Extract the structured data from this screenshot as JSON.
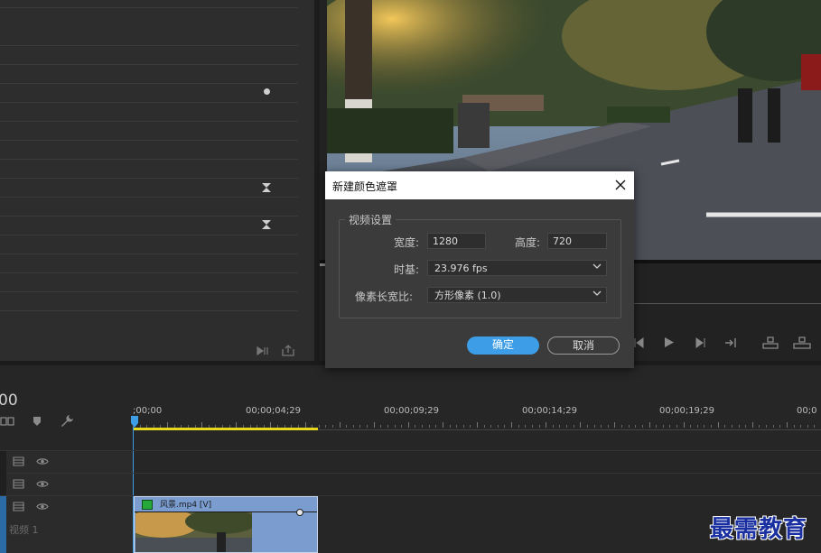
{
  "dialog": {
    "title": "新建颜色遮罩",
    "group_label": "视频设置",
    "width_label": "宽度:",
    "width_value": "1280",
    "height_label": "高度:",
    "height_value": "720",
    "timebase_label": "时基:",
    "timebase_value": "23.976 fps",
    "pixel_aspect_label": "像素长宽比:",
    "pixel_aspect_value": "方形像素 (1.0)",
    "ok_label": "确定",
    "cancel_label": "取消"
  },
  "timeline": {
    "timecode_partial": "00",
    "ruler_labels": [
      ";00;00",
      "00;00;04;29",
      "00;00;09;29",
      "00;00;14;29",
      "00;00;19;29",
      "00;0"
    ],
    "clip_label": "风景.mp4 [V]",
    "track_label": "视频 1"
  },
  "colors": {
    "accent_blue": "#3d9de6",
    "work_area": "#e6d71e",
    "clip_blue": "#7a9ccf"
  },
  "watermark": "最需教育"
}
